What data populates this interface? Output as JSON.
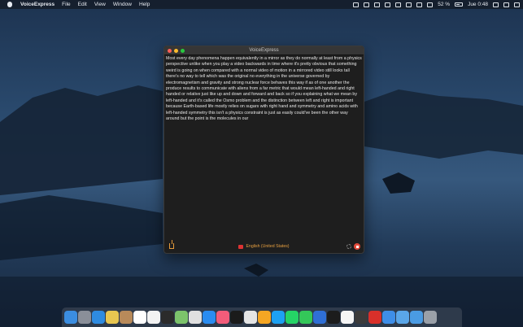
{
  "menubar": {
    "app_name": "VoiceExpress",
    "menus": [
      "File",
      "Edit",
      "View",
      "Window",
      "Help"
    ],
    "battery_percent": "52 %",
    "clock": "Jue 0:48"
  },
  "window": {
    "title": "VoiceExpress",
    "transcript": "Most every day phenomena happen equivalently in a mirror as they do normally at least from a physics perspective unlike when you play a video backwards in time where it's pretty obvious that something weird is going on when compared with a normal video of motion in a mirrored video still looks tall there's no way to tell which was the original no everything in the universe governed by electromagnetism and gravity and strong nuclear force behaves this way if as of one another the produce results to communicate with aliens from a far metric that would mean left-handed and right handed or relative just like up and down and forward and back so if you explaining what we mean by left-handed and it's called the Osmo problem and the distinction between left and right is important because Earth-based life mostly relies on sugars with right hand and symmetry and amino acids with left-handed symmetry this isn't a physics constraint is just as easily could've been the other way around but the point is the molecules in our",
    "language": "English (United States)"
  },
  "dock": {
    "icons": [
      "finder-icon",
      "launchpad-icon",
      "safari-icon",
      "notes-icon",
      "contacts-icon",
      "calendar-icon",
      "reminders-icon",
      "stocks-icon",
      "maps-icon",
      "photos-icon",
      "app-store-icon",
      "music-icon",
      "tv-icon",
      "chrome-icon",
      "home-icon",
      "twitter-icon",
      "whatsapp-icon",
      "find-my-icon",
      "xcode-icon",
      "terminal-icon",
      "textedit-icon",
      "voiceexpress-icon",
      "warning-icon",
      "keynote-icon",
      "folder-icon",
      "downloads-icon",
      "trash-icon"
    ],
    "colors": [
      "#3b8de0",
      "#8a8f99",
      "#2e8be0",
      "#e8c650",
      "#b88a5a",
      "#ffffff",
      "#f3f3f3",
      "#2b2b2b",
      "#7cc36b",
      "#e0e0e0",
      "#2a8cf0",
      "#f25c7a",
      "#1b1b1b",
      "#e5e5e5",
      "#f5a623",
      "#1da1f2",
      "#25d366",
      "#34c759",
      "#2f6fd6",
      "#1c1c1c",
      "#f5f5f5",
      "#3b3b3b",
      "#d9302a",
      "#3e8ee8",
      "#5aa6e8",
      "#4a9be3",
      "#9aa0a8"
    ]
  }
}
